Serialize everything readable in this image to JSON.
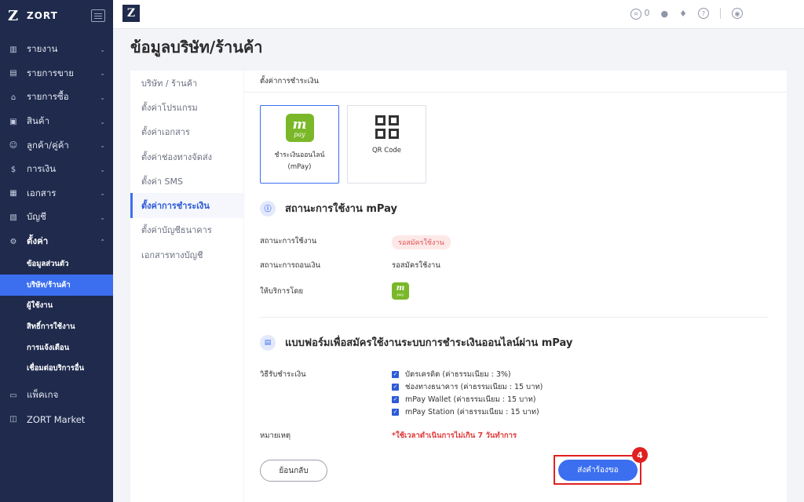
{
  "brand": {
    "name": "ZORT",
    "logo": "Z"
  },
  "sidebar": {
    "items": [
      {
        "label": "รายงาน",
        "icon": "chart-icon"
      },
      {
        "label": "รายการขาย",
        "icon": "clipboard-icon"
      },
      {
        "label": "รายการซื้อ",
        "icon": "cart-icon"
      },
      {
        "label": "สินค้า",
        "icon": "box-icon"
      },
      {
        "label": "ลูกค้า/คู่ค้า",
        "icon": "users-icon"
      },
      {
        "label": "การเงิน",
        "icon": "money-icon"
      },
      {
        "label": "เอกสาร",
        "icon": "document-icon"
      },
      {
        "label": "บัญชี",
        "icon": "book-icon"
      },
      {
        "label": "ตั้งค่า",
        "icon": "gear-icon"
      }
    ],
    "sub_items": [
      "ข้อมูลส่วนตัว",
      "บริษัท/ร้านค้า",
      "ผู้ใช้งาน",
      "สิทธิ์การใช้งาน",
      "การแจ้งเตือน",
      "เชื่อมต่อบริการอื่น"
    ],
    "after_items": [
      {
        "label": "แพ็คเกจ",
        "icon": "package-icon"
      },
      {
        "label": "ZORT Market",
        "icon": "shop-icon"
      }
    ]
  },
  "topbar": {
    "credit_count": "0"
  },
  "page_title": "ข้อมูลบริษัท/ร้านค้า",
  "settings_menu": [
    "บริษัท / ร้านค้า",
    "ตั้งค่าโปรแกรม",
    "ตั้งค่าเอกสาร",
    "ตั้งค่าช่องทางจัดส่ง",
    "ตั้งค่า SMS",
    "ตั้งค่าการชำระเงิน",
    "ตั้งค่าบัญชีธนาคาร",
    "เอกสารทางบัญชี"
  ],
  "panel": {
    "header": "ตั้งค่าการชำระเงิน",
    "methods": [
      {
        "label_line1": "ชำระเงินออนไลน์",
        "label_line2": "(mPay)"
      },
      {
        "label": "QR Code"
      }
    ],
    "mpay_logo": {
      "m": "m",
      "p": "pay"
    },
    "status_section": {
      "title": "สถานะการใช้งาน mPay",
      "rows": [
        {
          "label": "สถานะการใช้งาน",
          "value": "รอสมัครใช้งาน"
        },
        {
          "label": "สถานะการถอนเงิน",
          "value": "รอสมัครใช้งาน"
        },
        {
          "label": "ให้บริการโดย"
        }
      ]
    },
    "form_section": {
      "title": "แบบฟอร์มเพื่อสมัครใช้งานระบบการชำระเงินออนไลน์ผ่าน mPay",
      "payment_label": "วิธีรับชำระเงิน",
      "options": [
        "บัตรเครดิต (ค่าธรรมเนียม : 3%)",
        "ช่องทางธนาคาร (ค่าธรรมเนียม : 15 บาท)",
        "mPay Wallet (ค่าธรรมเนียม : 15 บาท)",
        "mPay Station (ค่าธรรมเนียม : 15 บาท)"
      ],
      "note_label": "หมายเหตุ",
      "note": "*ใช้เวลาดำเนินการไม่เกิน 7 วันทำการ"
    },
    "back_button": "ย้อนกลับ",
    "submit_button": "ส่งคำร้องขอ",
    "step_number": "4"
  },
  "colors": {
    "sidebar_bg": "#1f2a4d",
    "accent": "#3b6ff0",
    "highlight": "#e02020",
    "mpay_green": "#7ab829"
  }
}
